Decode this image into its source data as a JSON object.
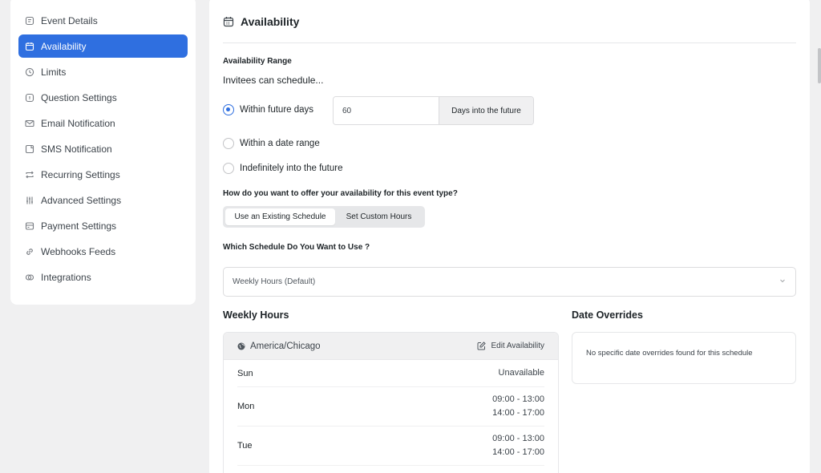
{
  "sidebar": {
    "items": [
      {
        "label": "Event Details",
        "icon": "document-icon"
      },
      {
        "label": "Availability",
        "icon": "calendar-icon"
      },
      {
        "label": "Limits",
        "icon": "clock-icon"
      },
      {
        "label": "Question Settings",
        "icon": "question-icon"
      },
      {
        "label": "Email Notification",
        "icon": "mail-icon"
      },
      {
        "label": "SMS Notification",
        "icon": "message-icon"
      },
      {
        "label": "Recurring Settings",
        "icon": "repeat-icon"
      },
      {
        "label": "Advanced Settings",
        "icon": "sliders-icon"
      },
      {
        "label": "Payment Settings",
        "icon": "payment-icon"
      },
      {
        "label": "Webhooks Feeds",
        "icon": "link-icon"
      },
      {
        "label": "Integrations",
        "icon": "integrations-icon"
      }
    ],
    "active_index": 1
  },
  "header": {
    "title": "Availability"
  },
  "range": {
    "section_label": "Availability Range",
    "subhead": "Invitees can schedule...",
    "options": [
      "Within future days",
      "Within a date range",
      "Indefinitely into the future"
    ],
    "selected": "Within future days",
    "days_value": "60",
    "days_suffix": "Days into the future"
  },
  "offer": {
    "question": "How do you want to offer your availability for this event type?",
    "options": [
      "Use an Existing Schedule",
      "Set Custom Hours"
    ],
    "selected": "Use an Existing Schedule"
  },
  "schedule": {
    "question": "Which Schedule Do You Want to Use ?",
    "value": "Weekly Hours (Default)"
  },
  "weekly": {
    "title": "Weekly Hours",
    "timezone": "America/Chicago",
    "edit_label": "Edit Availability",
    "days": [
      {
        "name": "Sun",
        "slots": [
          "Unavailable"
        ]
      },
      {
        "name": "Mon",
        "slots": [
          "09:00 - 13:00",
          "14:00 - 17:00"
        ]
      },
      {
        "name": "Tue",
        "slots": [
          "09:00 - 13:00",
          "14:00 - 17:00"
        ]
      }
    ]
  },
  "overrides": {
    "title": "Date Overrides",
    "empty_text": "No specific date overrides found for this schedule"
  },
  "colors": {
    "accent": "#2f6fe0",
    "background": "#f0f0f1"
  }
}
